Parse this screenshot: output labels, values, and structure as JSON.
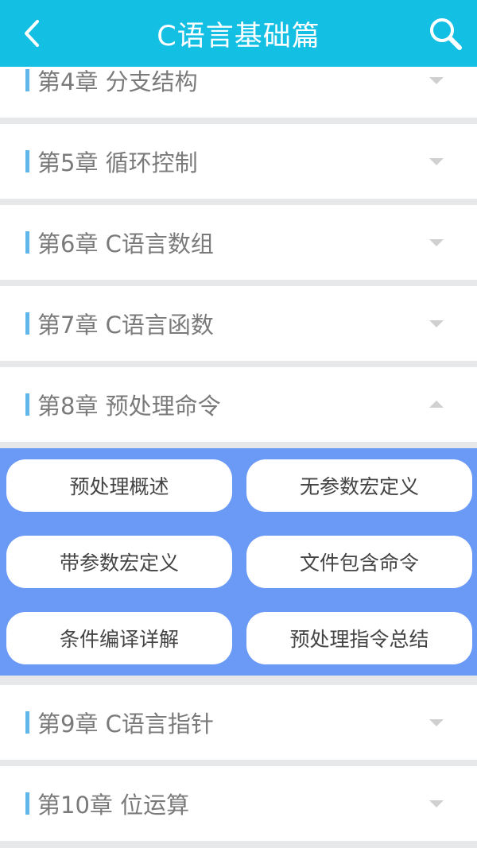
{
  "header": {
    "title": "C语言基础篇",
    "back_icon": "chevron-left-icon",
    "search_icon": "search-icon",
    "bg_color": "#14bfe4"
  },
  "chapters": [
    {
      "label": "第4章 分支结构",
      "expanded": false
    },
    {
      "label": "第5章 循环控制",
      "expanded": false
    },
    {
      "label": "第6章 C语言数组",
      "expanded": false
    },
    {
      "label": "第7章 C语言函数",
      "expanded": false
    },
    {
      "label": "第8章 预处理命令",
      "expanded": true
    },
    {
      "label": "第9章 C语言指针",
      "expanded": false
    },
    {
      "label": "第10章 位运算",
      "expanded": false
    }
  ],
  "sections": [
    "预处理概述",
    "无参数宏定义",
    "带参数宏定义",
    "文件包含命令",
    "条件编译详解",
    "预处理指令总结"
  ],
  "colors": {
    "accent_bar": "#5fb6ea",
    "panel_bg": "#6a99f6",
    "separator": "#e6e8e9"
  }
}
